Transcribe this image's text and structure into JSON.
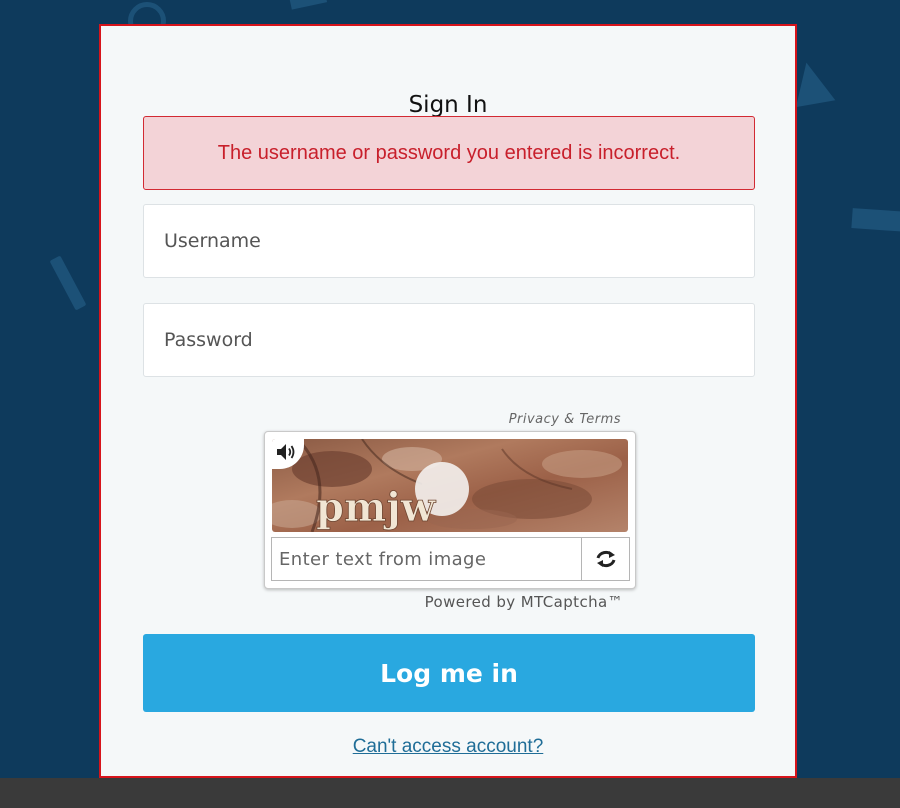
{
  "form": {
    "title": "Sign In",
    "error_message": "The username or password you entered is incorrect.",
    "username_placeholder": "Username",
    "password_placeholder": "Password",
    "login_button_label": "Log me in",
    "cant_access_link": "Can't access account?"
  },
  "captcha": {
    "privacy_terms_label": "Privacy & Terms",
    "image_text": "pmjw",
    "input_placeholder": "Enter text from image",
    "powered_by": "Powered by MTCaptcha™",
    "audio_icon": "speaker-icon",
    "refresh_icon": "refresh-icon"
  },
  "colors": {
    "background": "#0e3a5c",
    "card_border": "#d7141b",
    "error_text": "#c81f2b",
    "error_background": "#f3d3d7",
    "primary_button": "#29a8e0",
    "link": "#1f6d97"
  }
}
